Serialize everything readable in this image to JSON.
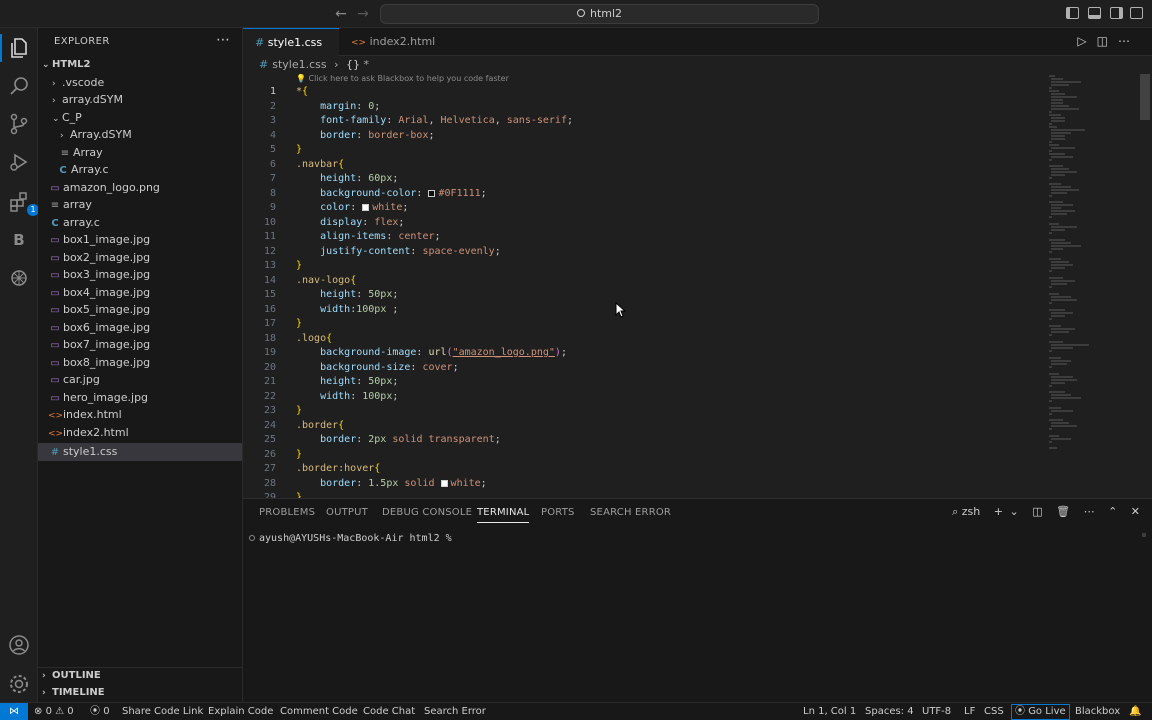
{
  "titlebar": {
    "search_text": "html2"
  },
  "activitybar": {
    "extensions_badge": "1"
  },
  "sidebar": {
    "title": "EXPLORER",
    "root": "HTML2",
    "items": [
      {
        "label": ".vscode",
        "kind": "folder",
        "expanded": false
      },
      {
        "label": "array.dSYM",
        "kind": "folder",
        "expanded": false
      },
      {
        "label": "C_P",
        "kind": "folder",
        "expanded": true
      },
      {
        "label": "Array.dSYM",
        "kind": "folder",
        "expanded": false
      },
      {
        "label": "Array",
        "kind": "file-binary"
      },
      {
        "label": "Array.c",
        "kind": "file-c"
      },
      {
        "label": "amazon_logo.png",
        "kind": "file-image"
      },
      {
        "label": "array",
        "kind": "file-binary"
      },
      {
        "label": "array.c",
        "kind": "file-c"
      },
      {
        "label": "box1_image.jpg",
        "kind": "file-image"
      },
      {
        "label": "box2_image.jpg",
        "kind": "file-image"
      },
      {
        "label": "box3_image.jpg",
        "kind": "file-image"
      },
      {
        "label": "box4_image.jpg",
        "kind": "file-image"
      },
      {
        "label": "box5_image.jpg",
        "kind": "file-image"
      },
      {
        "label": "box6_image.jpg",
        "kind": "file-image"
      },
      {
        "label": "box7_image.jpg",
        "kind": "file-image"
      },
      {
        "label": "box8_image.jpg",
        "kind": "file-image"
      },
      {
        "label": "car.jpg",
        "kind": "file-image"
      },
      {
        "label": "hero_image.jpg",
        "kind": "file-image"
      },
      {
        "label": "index.html",
        "kind": "file-html"
      },
      {
        "label": "index2.html",
        "kind": "file-html"
      },
      {
        "label": "style1.css",
        "kind": "file-css",
        "selected": true
      }
    ],
    "outline": "OUTLINE",
    "timeline": "TIMELINE"
  },
  "tabs": [
    {
      "label": "style1.css",
      "active": true,
      "icon": "#"
    },
    {
      "label": "index2.html",
      "active": false,
      "icon": "<>"
    }
  ],
  "breadcrumb": {
    "file": "style1.css",
    "symbol": "*"
  },
  "editor": {
    "hint": "Click here to ask Blackbox to help you code faster",
    "current_line": 1,
    "lines": [
      "*{",
      "    margin: 0;",
      "    font-family: Arial, Helvetica, sans-serif;",
      "    border: border-box;",
      "}",
      ".navbar{",
      "    height: 60px;",
      "    background-color: #0F1111;",
      "    color: white;",
      "    display: flex;",
      "    align-items: center;",
      "    justify-content: space-evenly;",
      "}",
      ".nav-logo{",
      "    height: 50px;",
      "    width:100px ;",
      "}",
      ".logo{",
      "    background-image: url(\"amazon_logo.png\");",
      "    background-size: cover;",
      "    height: 50px;",
      "    width: 100px;",
      "}",
      ".border{",
      "    border: 2px solid transparent;",
      "}",
      ".border:hover{",
      "    border: 1.5px solid white;",
      "}"
    ]
  },
  "panel": {
    "tabs": [
      "PROBLEMS",
      "OUTPUT",
      "DEBUG CONSOLE",
      "TERMINAL",
      "PORTS",
      "SEARCH ERROR"
    ],
    "active_tab": "TERMINAL",
    "shell": "zsh",
    "prompt": "ayush@AYUSHs-MacBook-Air html2 %"
  },
  "statusbar": {
    "errors": "0",
    "warnings": "0",
    "ports": "0",
    "items_left": [
      "Share Code Link",
      "Explain Code",
      "Comment Code",
      "Code Chat",
      "Search Error"
    ],
    "position": "Ln 1, Col 1",
    "spaces": "Spaces: 4",
    "encoding": "UTF-8",
    "eol": "LF",
    "language": "CSS",
    "golive": "Go Live",
    "blackbox": "Blackbox"
  },
  "colors": {
    "accent": "#0078d4",
    "swatch_dark": "#0F1111",
    "swatch_white": "#ffffff"
  }
}
